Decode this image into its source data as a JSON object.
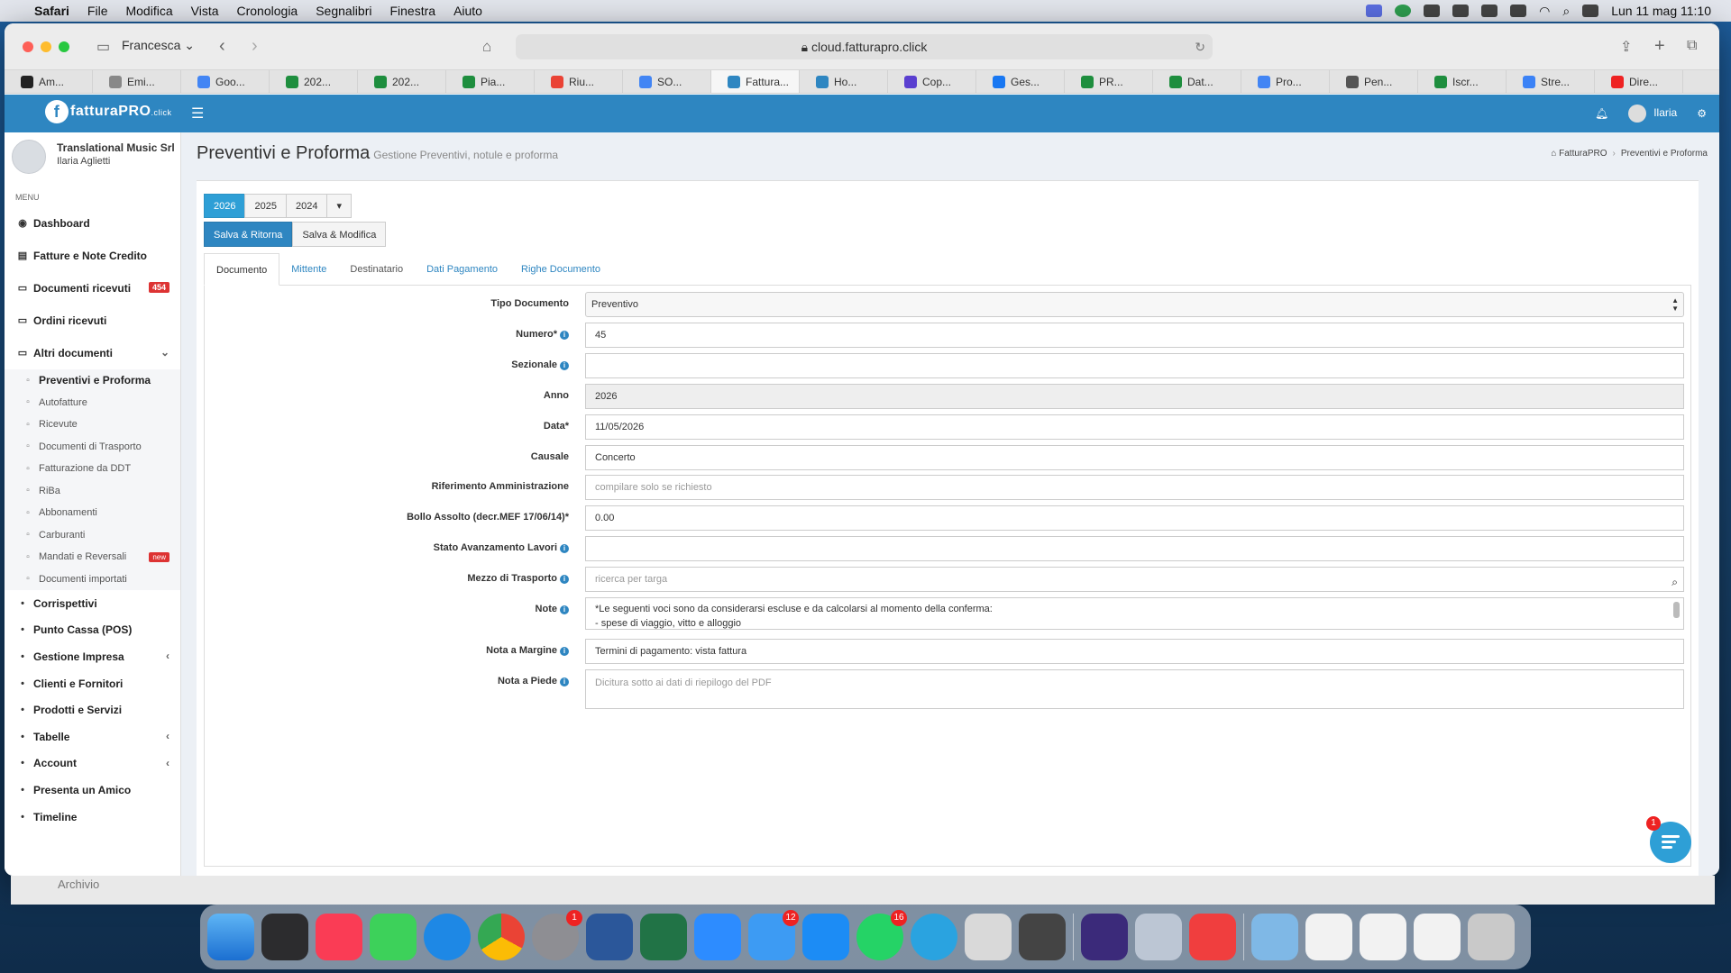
{
  "menubar": {
    "app": "Safari",
    "items": [
      "File",
      "Modifica",
      "Vista",
      "Cronologia",
      "Segnalibri",
      "Finestra",
      "Aiuto"
    ],
    "clock": "Lun 11 mag  11:10"
  },
  "browser": {
    "profile": "Francesca",
    "url": "cloud.fatturapro.click",
    "tabs": [
      {
        "label": "Am...",
        "color": "#222"
      },
      {
        "label": "Emi...",
        "color": "#888"
      },
      {
        "label": "Goo...",
        "color": "#4285f4"
      },
      {
        "label": "202...",
        "color": "#1e8e3e"
      },
      {
        "label": "202...",
        "color": "#1e8e3e"
      },
      {
        "label": "Pia...",
        "color": "#1e8e3e"
      },
      {
        "label": "Riu...",
        "color": "#ea4335"
      },
      {
        "label": "SO...",
        "color": "#4285f4"
      },
      {
        "label": "Fattura...",
        "color": "#2e86c1"
      },
      {
        "label": "Ho...",
        "color": "#2e86c1"
      },
      {
        "label": "Cop...",
        "color": "#5a3fd0"
      },
      {
        "label": "Ges...",
        "color": "#1877f2"
      },
      {
        "label": "PR...",
        "color": "#1e8e3e"
      },
      {
        "label": "Dat...",
        "color": "#1e8e3e"
      },
      {
        "label": "Pro...",
        "color": "#4285f4"
      },
      {
        "label": "Pen...",
        "color": "#555"
      },
      {
        "label": "Iscr...",
        "color": "#1e8e3e"
      },
      {
        "label": "Stre...",
        "color": "#3b82f6"
      },
      {
        "label": "Dire...",
        "color": "#e22"
      }
    ]
  },
  "app": {
    "logo": "fatturaPRO",
    "logo_sub": ".click",
    "user_name": "Ilaria"
  },
  "sidebar": {
    "company": "Translational Music Srl",
    "user": "Ilaria Aglietti",
    "menu_label": "MENU",
    "items_top": [
      {
        "label": "Dashboard",
        "icon": "dashboard-icon"
      },
      {
        "label": "Fatture e Note Credito",
        "icon": "file-icon"
      },
      {
        "label": "Documenti ricevuti",
        "icon": "inbox-icon",
        "badge": "454"
      },
      {
        "label": "Ordini ricevuti",
        "icon": "inbox-icon"
      },
      {
        "label": "Altri documenti",
        "icon": "folder-icon"
      }
    ],
    "sub": [
      "Preventivi e Proforma",
      "Autofatture",
      "Ricevute",
      "Documenti di Trasporto",
      "Fatturazione da DDT",
      "RiBa",
      "Abbonamenti",
      "Carburanti",
      "Mandati e Reversali",
      "Documenti importati"
    ],
    "new_badge": "new",
    "items_bottom": [
      "Corrispettivi",
      "Punto Cassa (POS)",
      "Gestione Impresa",
      "Clienti e Fornitori",
      "Prodotti e Servizi",
      "Tabelle",
      "Account",
      "Presenta un Amico",
      "Timeline"
    ]
  },
  "page": {
    "title": "Preventivi e Proforma",
    "subtitle": "Gestione Preventivi, notule e proforma",
    "breadcrumb": [
      "FatturaPRO",
      "Preventivi e Proforma"
    ],
    "years": [
      "2026",
      "2025",
      "2024"
    ],
    "save_return": "Salva & Ritorna",
    "save_edit": "Salva & Modifica",
    "tabs": [
      "Documento",
      "Mittente",
      "Destinatario",
      "Dati Pagamento",
      "Righe Documento"
    ]
  },
  "form": {
    "tipo": {
      "label": "Tipo Documento",
      "value": "Preventivo"
    },
    "numero": {
      "label": "Numero*",
      "value": "45"
    },
    "sezionale": {
      "label": "Sezionale",
      "value": ""
    },
    "anno": {
      "label": "Anno",
      "value": "2026"
    },
    "data": {
      "label": "Data*",
      "value": "11/05/2026"
    },
    "causale": {
      "label": "Causale",
      "value": "Concerto"
    },
    "rif": {
      "label": "Riferimento Amministrazione",
      "placeholder": "compilare solo se richiesto"
    },
    "bollo": {
      "label": "Bollo Assolto (decr.MEF 17/06/14)*",
      "value": "0.00"
    },
    "sal": {
      "label": "Stato Avanzamento Lavori",
      "value": ""
    },
    "mezzo": {
      "label": "Mezzo di Trasporto",
      "placeholder": "ricerca per targa"
    },
    "note": {
      "label": "Note",
      "line1": "*Le seguenti voci sono da considerarsi escluse e da calcolarsi al momento della conferma:",
      "line2": "- spese di viaggio, vitto e alloggio"
    },
    "margine": {
      "label": "Nota a Margine",
      "value": "Termini di pagamento: vista fattura"
    },
    "piede": {
      "label": "Nota a Piede",
      "placeholder": "Dicitura sotto ai dati di riepilogo del PDF"
    }
  },
  "chat_badge": "1",
  "behind_text": "Archivio",
  "dock": {
    "badges": {
      "settings": "1",
      "mail": "12",
      "whatsapp": "16"
    }
  }
}
